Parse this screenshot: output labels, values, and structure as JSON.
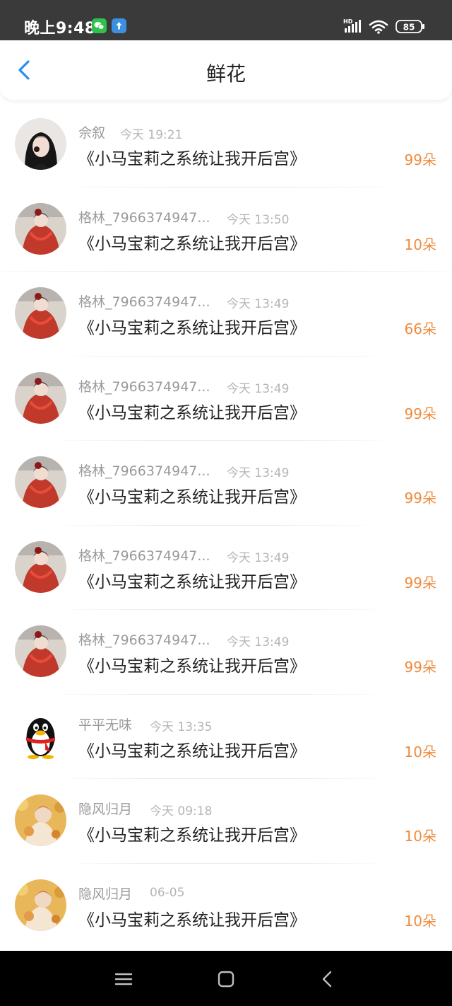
{
  "status_bar": {
    "time": "晚上9:48",
    "network": "HD",
    "battery": "85"
  },
  "header": {
    "title": "鲜花"
  },
  "items": [
    {
      "user": "佘叙",
      "time": "今天 19:21",
      "book": "《小马宝莉之系统让我开后宫》",
      "count": "99朵",
      "avatar": "girl-photo"
    },
    {
      "user": "格林_7966374947...",
      "time": "今天 13:50",
      "book": "《小马宝莉之系统让我开后宫》",
      "count": "10朵",
      "avatar": "red-robe-anime"
    },
    {
      "user": "格林_7966374947...",
      "time": "今天 13:49",
      "book": "《小马宝莉之系统让我开后宫》",
      "count": "66朵",
      "avatar": "red-robe-anime"
    },
    {
      "user": "格林_7966374947...",
      "time": "今天 13:49",
      "book": "《小马宝莉之系统让我开后宫》",
      "count": "99朵",
      "avatar": "red-robe-anime"
    },
    {
      "user": "格林_7966374947...",
      "time": "今天 13:49",
      "book": "《小马宝莉之系统让我开后宫》",
      "count": "99朵",
      "avatar": "red-robe-anime"
    },
    {
      "user": "格林_7966374947...",
      "time": "今天 13:49",
      "book": "《小马宝莉之系统让我开后宫》",
      "count": "99朵",
      "avatar": "red-robe-anime"
    },
    {
      "user": "格林_7966374947...",
      "time": "今天 13:49",
      "book": "《小马宝莉之系统让我开后宫》",
      "count": "99朵",
      "avatar": "red-robe-anime"
    },
    {
      "user": "平平无味",
      "time": "今天 13:35",
      "book": "《小马宝莉之系统让我开后宫》",
      "count": "10朵",
      "avatar": "qq-penguin"
    },
    {
      "user": "隐风归月",
      "time": "今天 09:18",
      "book": "《小马宝莉之系统让我开后宫》",
      "count": "10朵",
      "avatar": "autumn-anime"
    },
    {
      "user": "隐风归月",
      "time": "06-05",
      "book": "《小马宝莉之系统让我开后宫》",
      "count": "10朵",
      "avatar": "autumn-anime"
    }
  ],
  "colors": {
    "accent": "#2d8cf0",
    "count": "#f08a3c",
    "muted": "#9a9a9a"
  }
}
